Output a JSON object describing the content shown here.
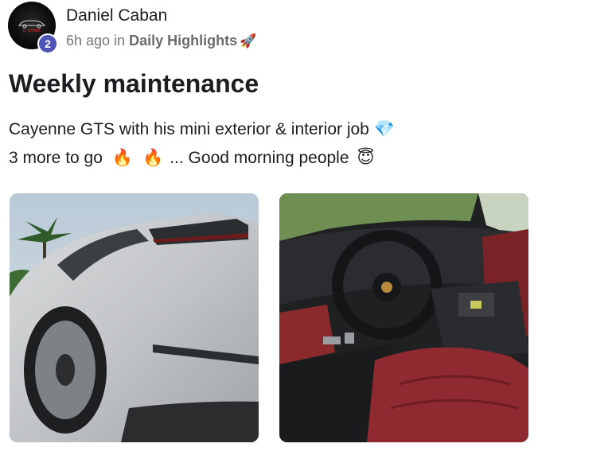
{
  "post": {
    "author_name": "Daniel Caban",
    "level": "2",
    "time_ago": "6h ago",
    "in_word": "in",
    "category": "Daily Highlights",
    "title": "Weekly maintenance",
    "line1": "Cayenne GTS with his mini exterior & interior job",
    "line2_a": "3 more to go",
    "line2_b": "... Good morning people"
  },
  "icons": {
    "rocket": "rocket-icon",
    "diamond": "gem-icon",
    "fire": "fire-icon",
    "smile": "smiling-face-icon"
  },
  "colors": {
    "badge": "#4f55b8",
    "meta_text": "#767676",
    "title_text": "#1c1d20"
  },
  "images": [
    {
      "alt": "Rear three-quarter view of white Porsche Cayenne GTS"
    },
    {
      "alt": "Interior of Porsche Cayenne GTS with red leather seats"
    }
  ]
}
